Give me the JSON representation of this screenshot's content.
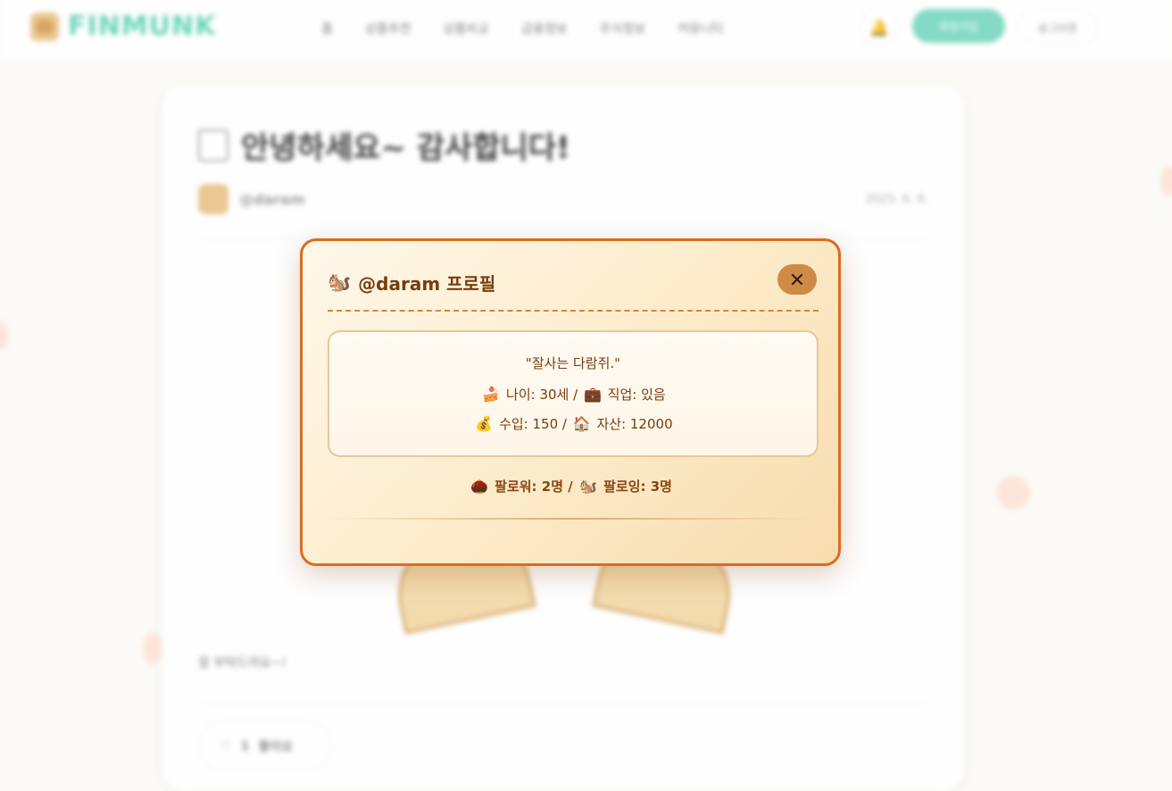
{
  "header": {
    "brand": "FINMUNK",
    "nav": [
      "홈",
      "상품추천",
      "상품비교",
      "금융정보",
      "주식정보",
      "커뮤니티"
    ],
    "signup_label": "회원가입",
    "login_label": "로그아웃"
  },
  "post": {
    "title": "안녕하세요~ 감사합니다!",
    "author": "@daram",
    "date": "2025. 6. 6.",
    "body": "잘 부탁드려요~!",
    "like_count": "1",
    "like_label": "좋아요"
  },
  "modal": {
    "title": "@daram 프로필",
    "quote": "\"잘사는 다람쥐.\"",
    "age_label": "나이: 30세",
    "job_label": "직업: 있음",
    "income_label": "수입: 150",
    "assets_label": "자산: 12000",
    "followers_label": "팔로워: 2명",
    "following_label": "팔로잉: 3명",
    "separator": "/"
  },
  "icons": {
    "title": "squirrel-icon",
    "close": "close-icon",
    "age": "cake-icon",
    "job": "briefcase-icon",
    "income": "money-bag-icon",
    "assets": "house-icon",
    "followers": "chestnut-icon",
    "following": "squirrel-icon"
  },
  "colors": {
    "modal_border": "#d96d1f",
    "modal_text": "#7a3b0c",
    "close_button": "#cf8a45",
    "brand_accent": "#5fd3b3"
  }
}
